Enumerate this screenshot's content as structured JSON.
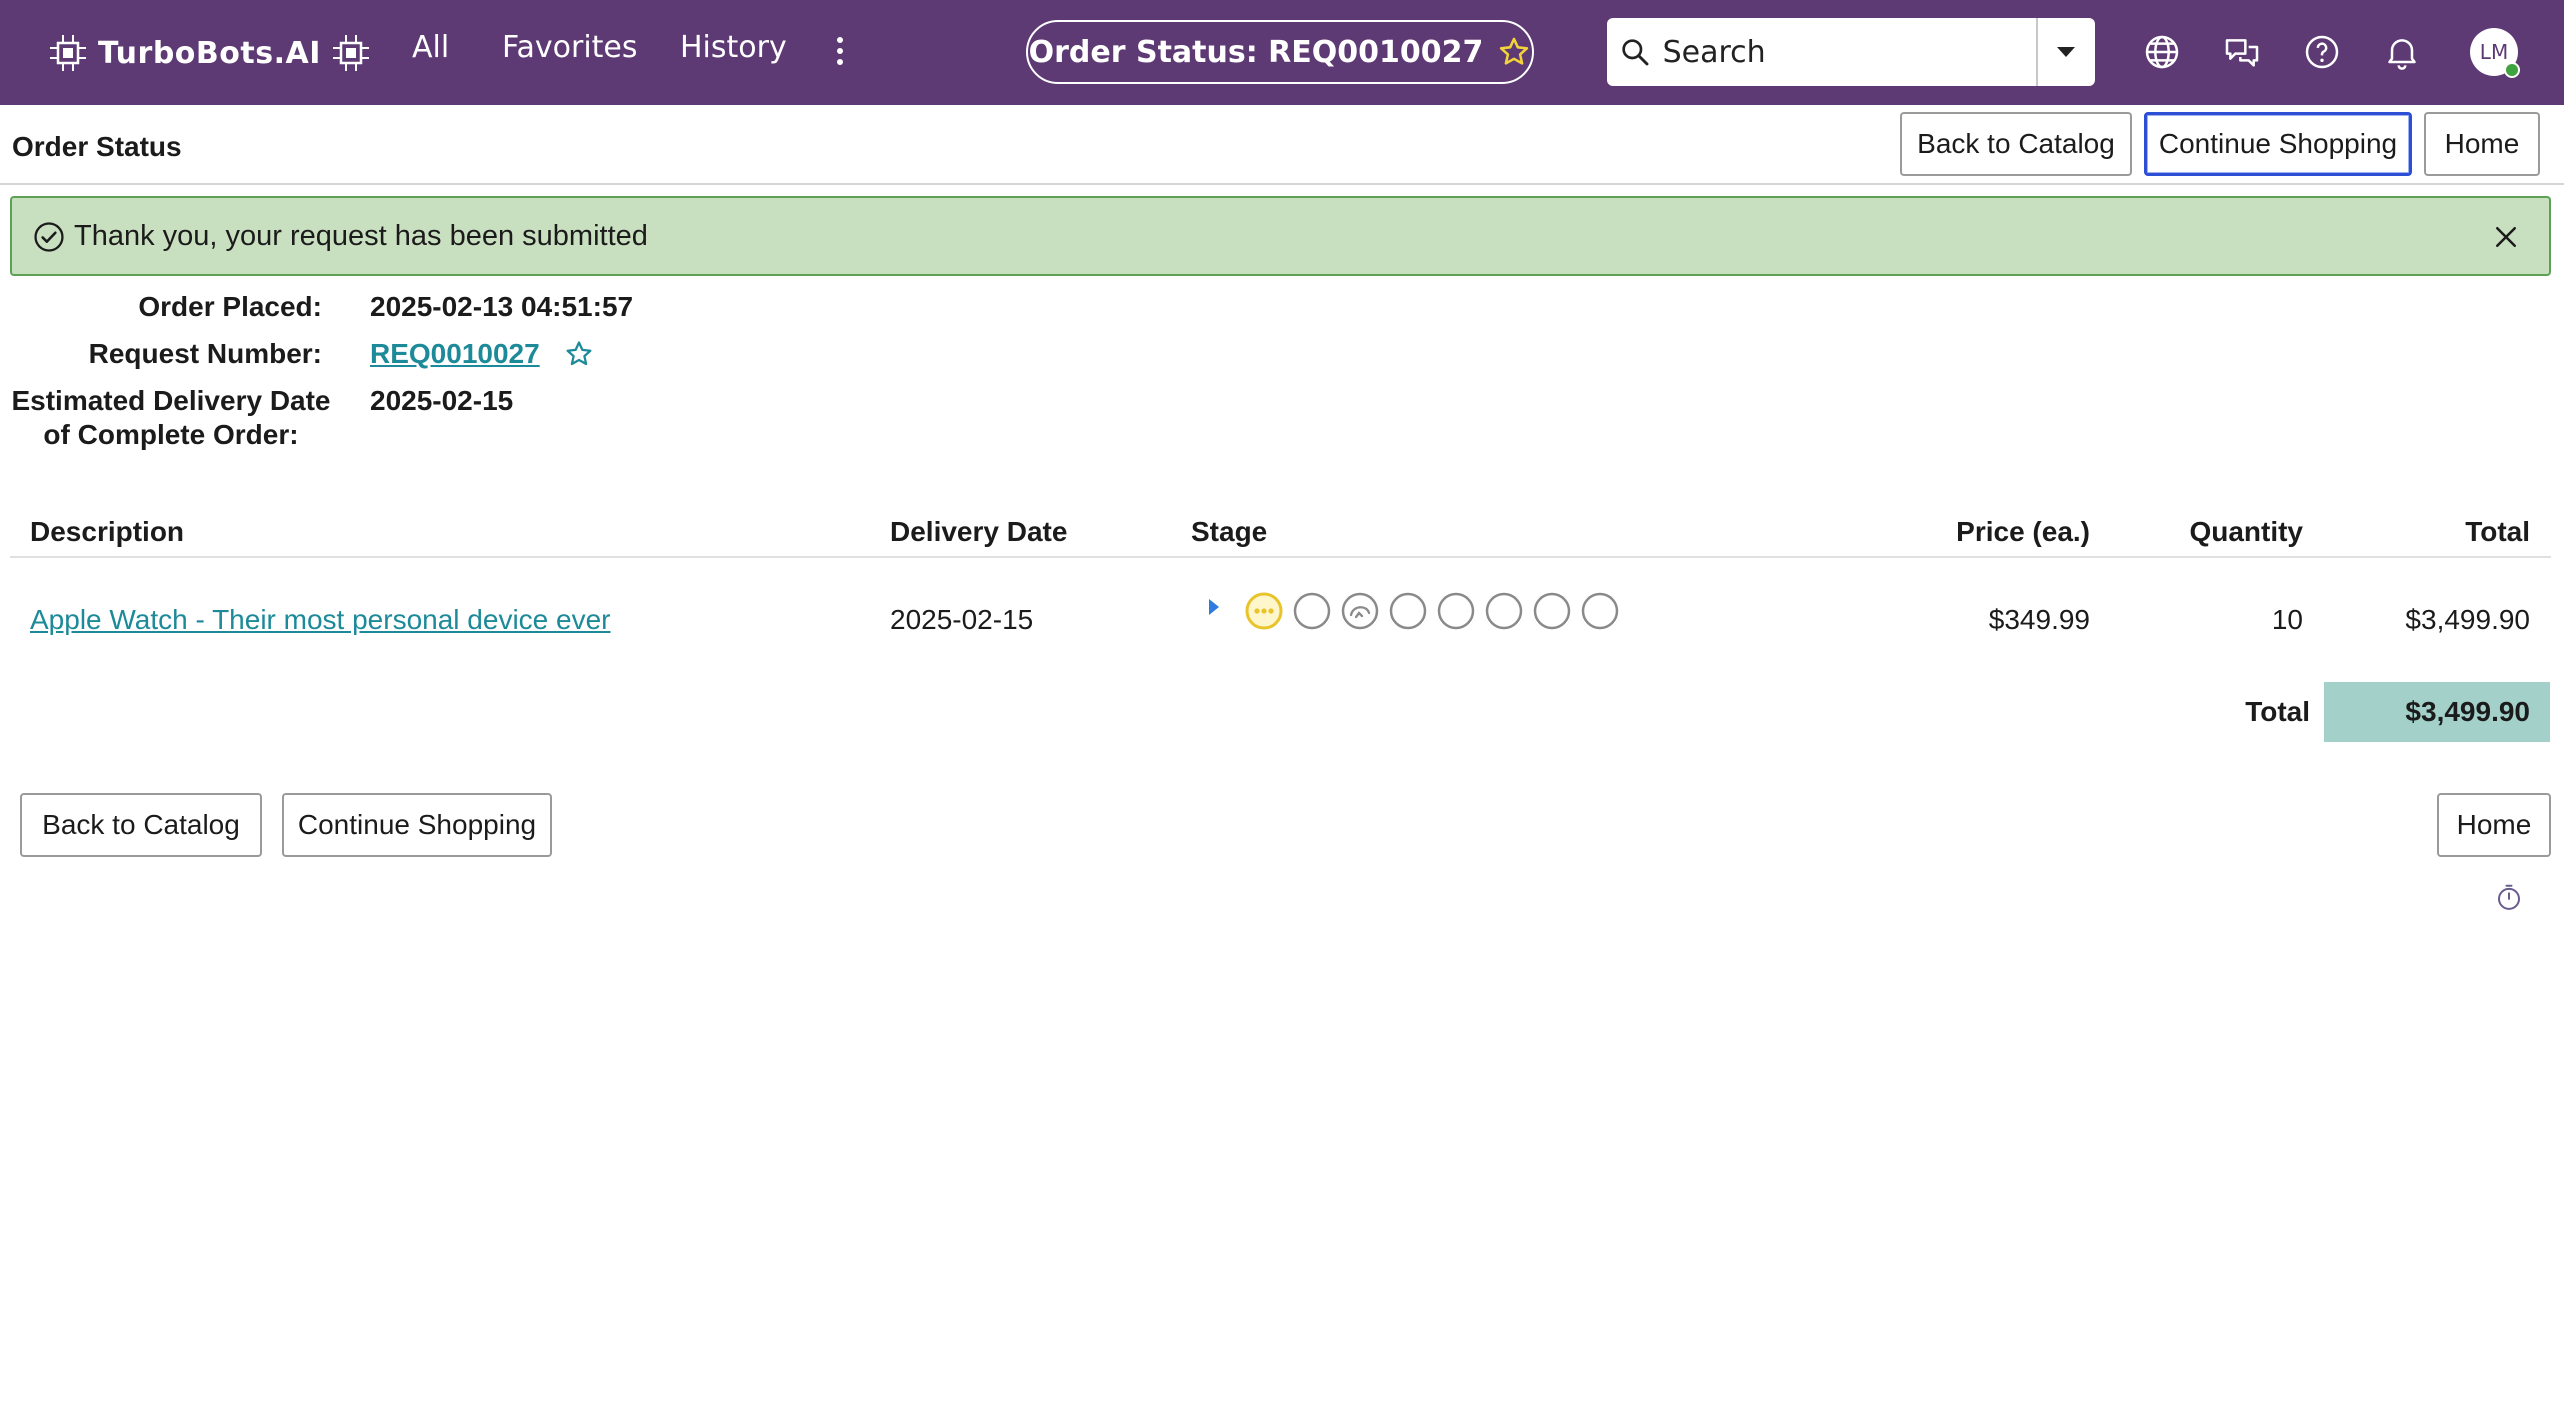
{
  "nav": {
    "logo_text": "TurboBots.AI",
    "links": [
      "All",
      "Favorites",
      "History"
    ],
    "title_pill": "Order Status: REQ0010027",
    "search_placeholder": "Search",
    "avatar_initials": "LM",
    "icons": [
      "globe-icon",
      "chat-icon",
      "help-icon",
      "bell-icon"
    ]
  },
  "header": {
    "title": "Order Status",
    "back_label": "Back to Catalog",
    "continue_label": "Continue Shopping",
    "home_label": "Home"
  },
  "alert": {
    "message": "Thank you, your request has been submitted",
    "status_color": "#c9e0c0"
  },
  "details": {
    "order_placed_label": "Order Placed:",
    "order_placed_value": "2025-02-13 04:51:57",
    "request_number_label": "Request Number:",
    "request_number_value": "REQ0010027",
    "delivery_label_line1": "Estimated Delivery Date",
    "delivery_label_line2": "of Complete Order:",
    "delivery_value": "2025-02-15"
  },
  "table": {
    "columns": [
      "Description",
      "Delivery Date",
      "Stage",
      "Price (ea.)",
      "Quantity",
      "Total"
    ],
    "rows": [
      {
        "description": "Apple Watch - Their most personal device ever",
        "delivery_date": "2025-02-15",
        "price": "$349.99",
        "quantity": "10",
        "total": "$3,499.90"
      }
    ],
    "total_label": "Total",
    "total_value": "$3,499.90",
    "total_color": "#a3d0c8"
  },
  "footer": {
    "back_label": "Back to Catalog",
    "continue_label": "Continue Shopping",
    "home_label": "Home"
  },
  "colors": {
    "nav_bg": "#5e3a75",
    "link": "#1d8a99",
    "focus": "#2c4fd6",
    "stage_active": "#e8c32a"
  }
}
